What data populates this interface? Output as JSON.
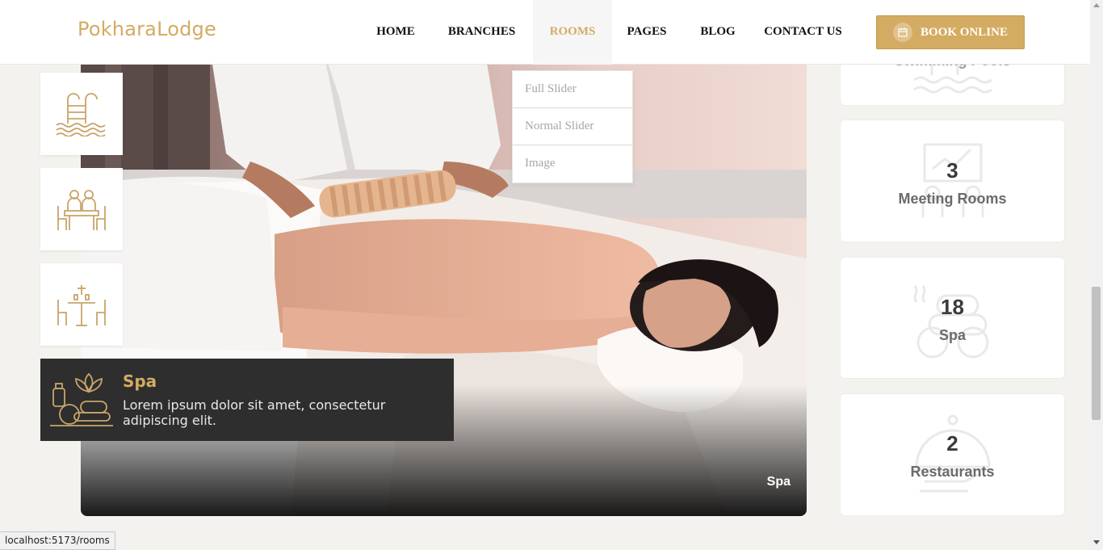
{
  "header": {
    "logo": "PokharaLodge",
    "nav": [
      {
        "label": "HOME",
        "active": false
      },
      {
        "label": "BRANCHES",
        "active": false
      },
      {
        "label": "ROOMS",
        "active": true
      },
      {
        "label": "PAGES",
        "active": false
      },
      {
        "label": "BLOG",
        "active": false
      },
      {
        "label": "CONTACT US",
        "active": false
      }
    ],
    "book_label": "BOOK ONLINE"
  },
  "dropdown": {
    "items": [
      "Full Slider",
      "Normal Slider",
      "Image"
    ]
  },
  "hero": {
    "caption": "Spa"
  },
  "thumbs": [
    {
      "icon": "swimming-pool-icon"
    },
    {
      "icon": "meeting-room-icon"
    },
    {
      "icon": "restaurant-icon"
    }
  ],
  "feature": {
    "icon": "spa-icon",
    "title": "Spa",
    "description": "Lorem ipsum dolor sit amet, consectetur adipiscing elit."
  },
  "stats": [
    {
      "number": "",
      "label": "Swimming Pools",
      "icon": "swimming-pool-icon"
    },
    {
      "number": "3",
      "label": "Meeting Rooms",
      "icon": "meeting-room-icon"
    },
    {
      "number": "18",
      "label": "Spa",
      "icon": "spa-icon"
    },
    {
      "number": "2",
      "label": "Restaurants",
      "icon": "restaurant-icon"
    }
  ],
  "status_bar": {
    "url": "localhost:5173/rooms"
  },
  "colors": {
    "accent": "#d4ab62",
    "dark_card": "#2e2e2e",
    "page_bg": "#f3f2ef"
  }
}
